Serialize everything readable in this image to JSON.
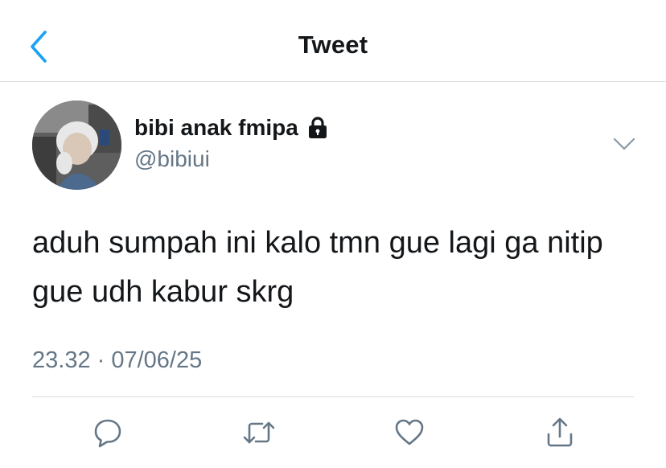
{
  "header": {
    "title": "Tweet",
    "back_icon": "chevron-left-icon",
    "accent_color": "#1da1f2"
  },
  "tweet": {
    "author": {
      "display_name": "bibi anak fmipa",
      "handle": "@bibiui",
      "protected_icon": "lock-icon"
    },
    "text": "aduh sumpah ini kalo tmn gue lagi ga nitip gue udh kabur skrg",
    "timestamp": "23.32 · 07/06/25"
  },
  "actions": {
    "reply_icon": "reply-icon",
    "retweet_icon": "retweet-icon",
    "like_icon": "heart-icon",
    "share_icon": "share-icon"
  },
  "colors": {
    "text_primary": "#14171a",
    "text_secondary": "#657786",
    "divider": "#d9dde1",
    "icon": "#657786"
  }
}
